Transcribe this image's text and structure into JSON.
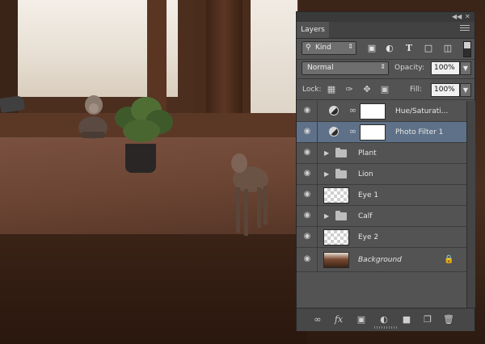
{
  "panel": {
    "tab_label": "Layers",
    "filter": {
      "kind_label": "Kind",
      "icons": [
        "image-filter-icon",
        "adjustment-filter-icon",
        "type-filter-icon",
        "shape-filter-icon",
        "smart-object-filter-icon"
      ]
    },
    "blend_mode": "Normal",
    "opacity_label": "Opacity:",
    "opacity_value": "100%",
    "lock_label": "Lock:",
    "fill_label": "Fill:",
    "fill_value": "100%"
  },
  "layers": [
    {
      "name": "Hue/Saturati...",
      "type": "adjustment",
      "selected": false
    },
    {
      "name": "Photo Filter 1",
      "type": "adjustment",
      "selected": true
    },
    {
      "name": "Plant",
      "type": "group",
      "selected": false
    },
    {
      "name": "Lion",
      "type": "group",
      "selected": false
    },
    {
      "name": "Eye 1",
      "type": "layer",
      "selected": false
    },
    {
      "name": "Calf",
      "type": "group",
      "selected": false
    },
    {
      "name": "Eye 2",
      "type": "layer",
      "selected": false
    },
    {
      "name": "Background",
      "type": "background",
      "selected": false
    }
  ],
  "footer_icons": [
    "link-layers-icon",
    "fx-icon",
    "add-mask-icon",
    "new-adjustment-icon",
    "new-group-icon",
    "new-layer-icon",
    "delete-layer-icon"
  ],
  "colors": {
    "panel_bg": "#535353",
    "selected_row": "#5e7188",
    "field_bg": "#f0f0f0"
  }
}
